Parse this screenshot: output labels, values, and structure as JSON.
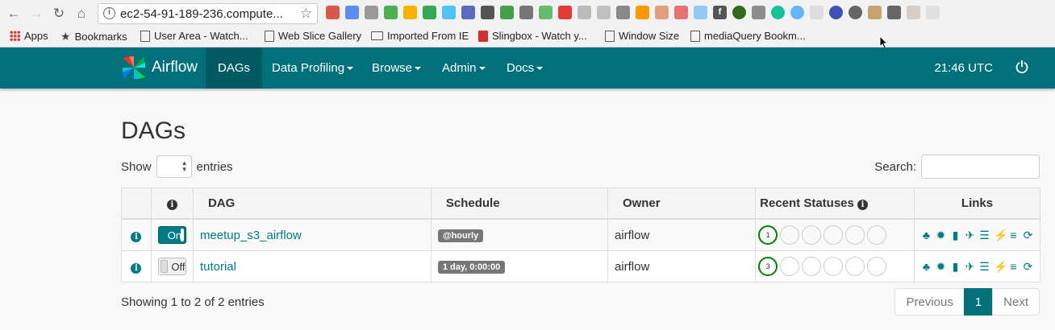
{
  "browser": {
    "url": "ec2-54-91-189-236.compute...",
    "bookmarks": [
      {
        "label": "Apps",
        "icon": "apps-icon"
      },
      {
        "label": "Bookmarks",
        "icon": "star-icon"
      },
      {
        "label": "User Area - Watch...",
        "icon": "page-icon"
      },
      {
        "label": "Web Slice Gallery",
        "icon": "page-icon"
      },
      {
        "label": "Imported From IE",
        "icon": "folder-icon"
      },
      {
        "label": "Slingbox - Watch y...",
        "icon": "slingbox-icon"
      },
      {
        "label": "Window Size",
        "icon": "page-icon"
      },
      {
        "label": "mediaQuery Bookm...",
        "icon": "page-icon"
      }
    ]
  },
  "navbar": {
    "brand": "Airflow",
    "items": [
      {
        "label": "DAGs",
        "active": true,
        "dropdown": false
      },
      {
        "label": "Data Profiling",
        "dropdown": true
      },
      {
        "label": "Browse",
        "dropdown": true
      },
      {
        "label": "Admin",
        "dropdown": true
      },
      {
        "label": "Docs",
        "dropdown": true
      }
    ],
    "time": "21:46 UTC"
  },
  "page": {
    "title": "DAGs",
    "show_label": "Show",
    "entries_label": "entries",
    "search_label": "Search:",
    "search_value": ""
  },
  "table": {
    "headers": {
      "dag": "DAG",
      "schedule": "Schedule",
      "owner": "Owner",
      "recent": "Recent Statuses",
      "links": "Links"
    },
    "rows": [
      {
        "toggle": "On",
        "dag": "meetup_s3_airflow",
        "schedule": "@hourly",
        "owner": "airflow",
        "status_count": "1"
      },
      {
        "toggle": "Off",
        "dag": "tutorial",
        "schedule": "1 day, 0:00:00",
        "owner": "airflow",
        "status_count": "3"
      }
    ]
  },
  "footer": {
    "showing": "Showing 1 to 2 of 2 entries",
    "previous": "Previous",
    "page": "1",
    "next": "Next"
  },
  "colors": {
    "navbar": "#00717a",
    "accent": "#017c86",
    "success": "#008000"
  }
}
